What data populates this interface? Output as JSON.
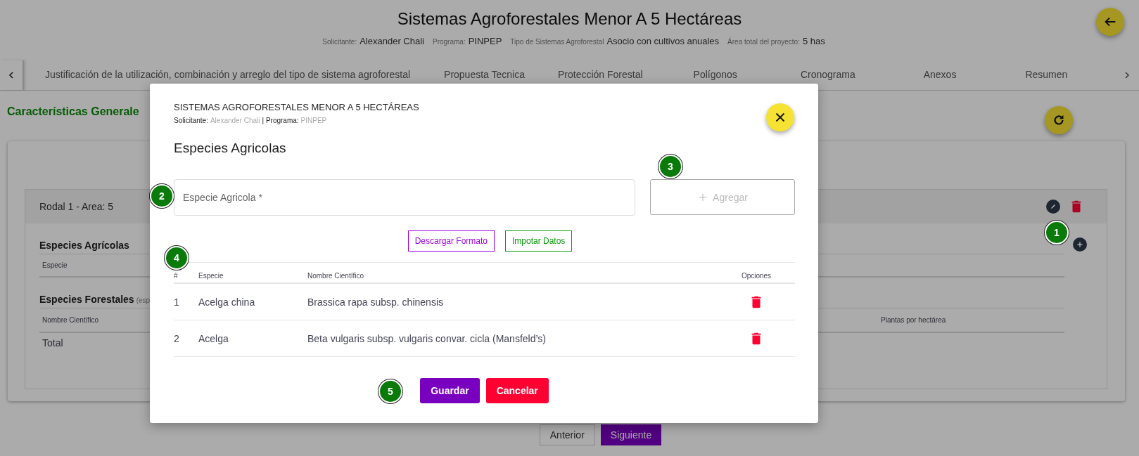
{
  "header": {
    "title": "Sistemas Agroforestales Menor A 5 Hectáreas",
    "meta": [
      {
        "label": "Solicitante:",
        "value": "Alexander Chali"
      },
      {
        "label": "Programa:",
        "value": "PINPEP"
      },
      {
        "label": "Tipo de Sistemas Agroforestal",
        "value": "Asocio con cultivos anuales"
      },
      {
        "label": "Área total del proyecto:",
        "value": "5 has"
      }
    ]
  },
  "tabs": [
    {
      "label": "Justificación de la utilización, combinación y arreglo del tipo de sistema agroforestal",
      "selected": false
    },
    {
      "label": "Propuesta Tecnica",
      "selected": false
    },
    {
      "label": "Protección Forestal",
      "selected": false
    },
    {
      "label": "Polígonos",
      "selected": false
    },
    {
      "label": "Cronograma",
      "selected": false
    },
    {
      "label": "Anexos",
      "selected": false
    },
    {
      "label": "Resumen",
      "selected": false
    }
  ],
  "section_title": "Características Generale",
  "rodal": {
    "title": "Rodal 1 - Area: 5",
    "agricolas": {
      "title": "Especies Agrícolas",
      "columns": [
        "Especie"
      ]
    },
    "forestales": {
      "title": "Especies Forestales",
      "note": "(esp",
      "columns": [
        "Nombre Científico",
        "Plantas por hectárea"
      ],
      "total_label": "Total"
    }
  },
  "pager": [
    "Anterior",
    "Siguiente"
  ],
  "modal": {
    "title": "SISTEMAS AGROFORESTALES MENOR A 5 HECTÁREAS",
    "meta": [
      {
        "label": "Solicitante:",
        "value": "Alexander Chali"
      },
      {
        "label": "| Programa:",
        "value": "PINPEP"
      }
    ],
    "heading": "Especies Agricolas",
    "field": {
      "placeholder": "Especie Agricola *"
    },
    "add_button": {
      "label": "Agregar",
      "disabled": true
    },
    "download_button": "Descargar Formato",
    "import_button": "Impotar Datos",
    "table": {
      "columns": [
        "#",
        "Especie",
        "Nombre Científico",
        "Opciones"
      ],
      "rows": [
        {
          "cells": [
            "1",
            "Acelga china",
            "Brassica rapa subsp. chinensis"
          ]
        },
        {
          "cells": [
            "2",
            "Acelga",
            "Beta vulgaris subsp. vulgaris convar. cicla (Mansfeld’s)"
          ]
        }
      ]
    },
    "save_button": "Guardar",
    "cancel_button": "Cancelar"
  },
  "annotations": [
    "1",
    "2",
    "3",
    "4",
    "5"
  ]
}
